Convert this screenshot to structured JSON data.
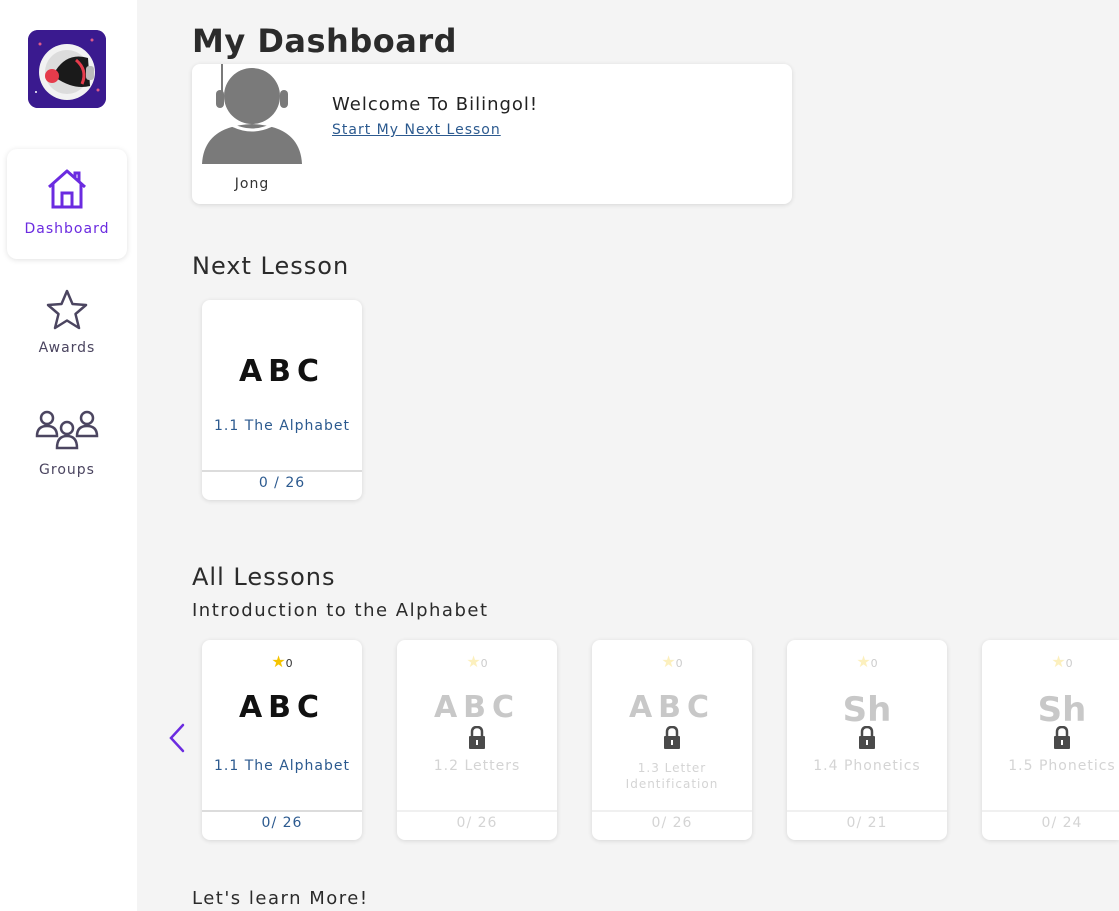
{
  "sidebar": {
    "items": [
      {
        "label": "Dashboard",
        "icon": "home-icon",
        "active": true
      },
      {
        "label": "Awards",
        "icon": "star-icon",
        "active": false
      },
      {
        "label": "Groups",
        "icon": "groups-icon",
        "active": false
      }
    ]
  },
  "header": {
    "title": "My Dashboard"
  },
  "welcome": {
    "user_name": "Jong",
    "message": "Welcome To Bilingol!",
    "link": "Start My Next Lesson"
  },
  "next_lesson": {
    "section_title": "Next Lesson",
    "card": {
      "glyph": "ABC",
      "name": "1.1 The Alphabet",
      "progress": "0 / 26"
    }
  },
  "all_lessons": {
    "section_title": "All Lessons",
    "unit_title": "Introduction to the Alphabet",
    "lessons": [
      {
        "stars": "0",
        "glyph": "ABC",
        "name": "1.1 The Alphabet",
        "progress": "0/ 26",
        "locked": false
      },
      {
        "stars": "0",
        "glyph": "ABC",
        "name": "1.2 Letters",
        "progress": "0/ 26",
        "locked": true
      },
      {
        "stars": "0",
        "glyph": "ABC",
        "name": "1.3 Letter Identification",
        "progress": "0/ 26",
        "locked": true
      },
      {
        "stars": "0",
        "glyph": "Sh",
        "name": "1.4 Phonetics",
        "progress": "0/ 21",
        "locked": true
      },
      {
        "stars": "0",
        "glyph": "Sh",
        "name": "1.5 Phonetics",
        "progress": "0/ 24",
        "locked": true
      }
    ]
  },
  "more": {
    "title": "Let's learn More!"
  },
  "colors": {
    "accent": "#6b2be0",
    "link": "#2c5a8f",
    "star": "#f5c400",
    "background": "#f4f4f4"
  }
}
